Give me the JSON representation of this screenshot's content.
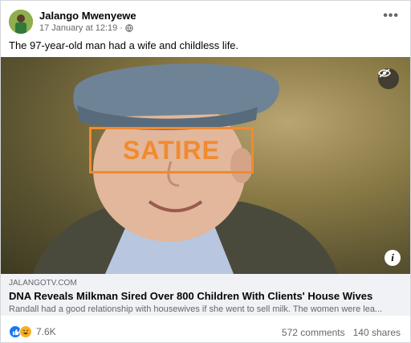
{
  "post": {
    "author": "Jalango Mwenyewe",
    "date": "17 January at 12:19",
    "separator": "·",
    "caption": "The 97-year-old man had a wife and childless life.",
    "more_label": "•••"
  },
  "image": {
    "stamp_text": "SATIRE",
    "info_label": "i"
  },
  "link_preview": {
    "domain": "JALANGOTV.COM",
    "headline": "DNA Reveals Milkman Sired Over 800 Children With Clients' House Wives",
    "description": "Randall had a good relationship with housewives if she went to sell milk. The women were lea..."
  },
  "footer": {
    "reaction_count": "7.6K",
    "comments": "572 comments",
    "shares": "140 shares"
  },
  "colors": {
    "stamp": "#f28a2e",
    "like": "#1877f2",
    "haha": "#f7b125"
  },
  "icons": [
    "globe-icon",
    "more-options-icon",
    "hide-eye-icon",
    "info-icon",
    "like-reaction-icon",
    "haha-reaction-icon"
  ]
}
